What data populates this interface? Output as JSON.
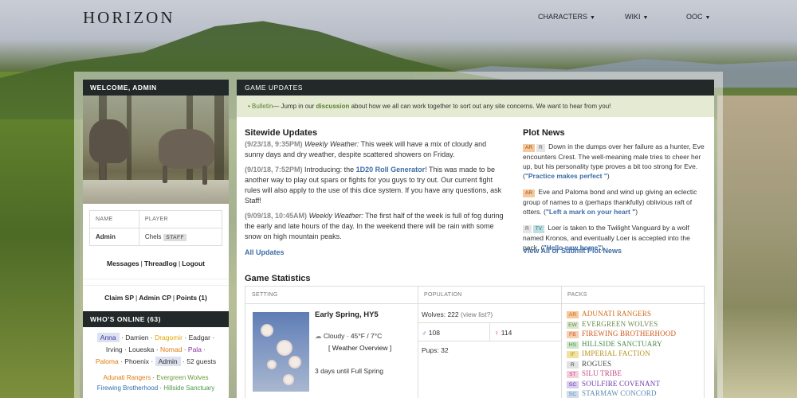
{
  "site": {
    "logo": "HORIZON",
    "nav": [
      {
        "label": "CHARACTERS"
      },
      {
        "label": "WIKI"
      },
      {
        "label": "OOC"
      }
    ]
  },
  "sidebar": {
    "welcome": "WELCOME, ADMIN",
    "table": {
      "col_name": "NAME",
      "col_player": "PLAYER",
      "name": "Admin",
      "player": "Chels",
      "badge": "STAFF"
    },
    "links1": [
      "Messages",
      "Threadlog",
      "Logout"
    ],
    "links2": [
      "Claim SP",
      "Admin CP",
      "Points (1)"
    ],
    "online_title": "WHO'S ONLINE (63)",
    "online_users": [
      {
        "name": "Anna",
        "color": "#3a3aa8"
      },
      {
        "name": "Damien",
        "color": "#333333"
      },
      {
        "name": "Dragomir",
        "color": "#e0a800"
      },
      {
        "name": "Eadgar",
        "color": "#333333"
      },
      {
        "name": "Irving",
        "color": "#333333"
      },
      {
        "name": "Loueska",
        "color": "#333333"
      },
      {
        "name": "Nomad",
        "color": "#e07a10"
      },
      {
        "name": "Pala",
        "color": "#8b2fa8"
      },
      {
        "name": "Paloma",
        "color": "#e07a10"
      },
      {
        "name": "Phoenix",
        "color": "#333333"
      },
      {
        "name": "Admin",
        "color": "#333333"
      }
    ],
    "guests": "52 guests",
    "online_packs": [
      {
        "name": "Adunati Rangers",
        "color": "#e07a10"
      },
      {
        "name": "Evergreen Wolves",
        "color": "#6e9a3a"
      },
      {
        "name": "Firewing Brotherhood",
        "color": "#2e6fb0"
      },
      {
        "name": "Hillside Sanctuary",
        "color": "#4a9a4a"
      }
    ]
  },
  "main": {
    "header": "GAME UPDATES",
    "bulletin_prefix": "Bulletin",
    "bulletin_text1": "— Jump in our ",
    "bulletin_link": "discussion",
    "bulletin_text2": " about how we all can work together to sort out any site concerns. We want to hear from you!",
    "sitewide_title": "Sitewide Updates",
    "updates": [
      {
        "date": "(9/23/18, 9:35PM)",
        "label": "Weekly Weather:",
        "text": " This week will have a mix of cloudy and sunny days and dry weather, despite scattered showers on Friday."
      },
      {
        "date": "(9/10/18, 7:52PM)",
        "pre": " Introducing: the ",
        "link": "1D20 Roll Generator",
        "text": "! This was made to be another way to play out spars or fights for you guys to try out. Our current fight rules will also apply to the use of this dice system. If you have any questions, ask Staff!"
      },
      {
        "date": "(9/09/18, 10:45AM)",
        "label": "Weekly Weather:",
        "text": " The first half of the week is full of fog during the early and late hours of the day. In the weekend there will be rain with some snow on high mountain peaks."
      }
    ],
    "all_updates": "All Updates",
    "plot_title": "Plot News",
    "plots": [
      {
        "tags": [
          "AR",
          "R"
        ],
        "text": " Down in the dumps over her failure as a hunter, Eve encounters Crest. The well-meaning male tries to cheer her up, but his personality type proves a bit too strong for Eve. (",
        "link": "\"Practice makes perfect \"",
        "end": ")"
      },
      {
        "tags": [
          "AR"
        ],
        "text": " Eve and Paloma bond and wind up giving an eclectic group of names to a (perhaps thankfully) oblivious raft of otters. (",
        "link": "\"Left a mark on your heart \"",
        "end": ")"
      },
      {
        "tags": [
          "R",
          "TV"
        ],
        "text": " Loer is taken to the Twilight Vanguard by a wolf named Kronos, and eventually Loer is accepted into the pack. (",
        "link": "\"Hello new home\"",
        "end": ")"
      }
    ],
    "plot_link": "View All or Submit Plot News",
    "stats_title": "Game Statistics",
    "stats": {
      "setting_head": "SETTING",
      "population_head": "POPULATION",
      "packs_head": "PACKS",
      "season": "Early Spring, HY5",
      "weather": "Cloudy · 45°F / 7°C",
      "weather_link": "[ Weather Overview ]",
      "full_spring": "3 days until Full Spring",
      "wolves_label": "Wolves:",
      "wolves_count": "222",
      "wolves_link": "(view list?)",
      "male_count": "108",
      "female_count": "114",
      "pups_label": "Pups:",
      "pups_count": "32",
      "packs": [
        {
          "abbr": "AR",
          "name": "ADUNATI RANGERS",
          "color": "#d06a18",
          "tagbg": "#f6c89c"
        },
        {
          "abbr": "EW",
          "name": "EVERGREEN WOLVES",
          "color": "#6e8a4a",
          "tagbg": "#dbe6cc"
        },
        {
          "abbr": "FB",
          "name": "FIREWING BROTHERHOOD",
          "color": "#d0561b",
          "tagbg": "#f8cdb0"
        },
        {
          "abbr": "HS",
          "name": "HILLSIDE SANCTUARY",
          "color": "#4a8a4a",
          "tagbg": "#cfe6c8"
        },
        {
          "abbr": "IF",
          "name": "IMPERIAL FACTION",
          "color": "#b8901e",
          "tagbg": "#f2e2a0"
        },
        {
          "abbr": "R",
          "name": "ROGUES",
          "color": "#444444",
          "tagbg": "#e2e2e2"
        },
        {
          "abbr": "ST",
          "name": "SILU TRIBE",
          "color": "#c0487a",
          "tagbg": "#f6cfdf"
        },
        {
          "abbr": "SC",
          "name": "SOULFIRE COVENANT",
          "color": "#6a3aa8",
          "tagbg": "#d8ccef"
        },
        {
          "abbr": "SC",
          "name": "STARMAW CONCORD",
          "color": "#5b8ab0",
          "tagbg": "#cddded"
        }
      ]
    }
  }
}
